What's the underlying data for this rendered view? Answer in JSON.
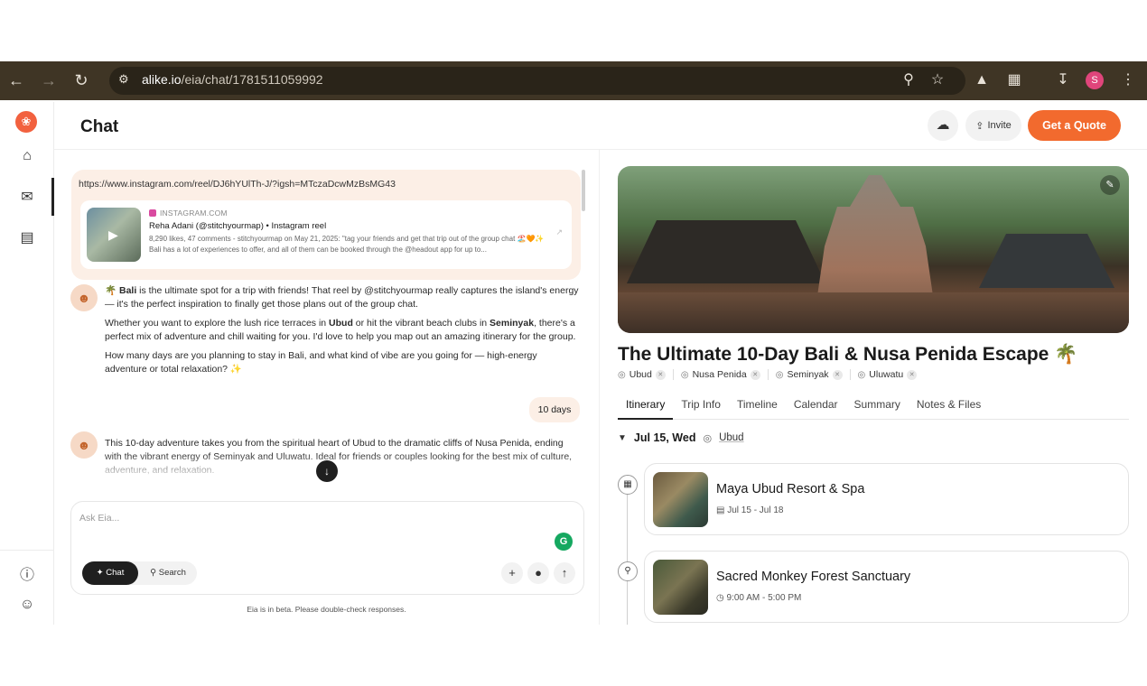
{
  "browser": {
    "url_host": "alike.io",
    "url_path": "/eia/chat/1781511059992",
    "profile_initial": "S"
  },
  "app": {
    "page_title": "Chat",
    "header": {
      "invite_label": "Invite",
      "quote_label": "Get a Quote"
    }
  },
  "chat": {
    "link_message": "https://www.instagram.com/reel/DJ6hYUlTh-J/?igsh=MTczaDcwMzBsMG43",
    "instagram_card": {
      "source": "INSTAGRAM.COM",
      "title": "Reha Adani (@stitchyourmap) • Instagram reel",
      "description": "8,290 likes, 47 comments - stitchyourmap on May 21, 2025: \"tag your friends and get that trip out of the group chat 🏖️🧡✨ Bali has a lot of experiences to offer, and all of them can be booked through the @headout app for up to..."
    },
    "bot_msg1_p1_emoji": "🌴",
    "bot_msg1_p1_bold": "Bali",
    "bot_msg1_p1_rest": " is the ultimate spot for a trip with friends! That reel by @stitchyourmap really captures the island's energy — it's the perfect inspiration to finally get those plans out of the group chat.",
    "bot_msg1_p2_a": "Whether you want to explore the lush rice terraces in ",
    "bot_msg1_p2_b": "Ubud",
    "bot_msg1_p2_c": " or hit the vibrant beach clubs in ",
    "bot_msg1_p2_d": "Seminyak",
    "bot_msg1_p2_e": ", there's a perfect mix of adventure and chill waiting for you. I'd love to help you map out an amazing itinerary for the group.",
    "bot_msg1_p3": "How many days are you planning to stay in Bali, and what kind of vibe are you going for — high-energy adventure or total relaxation? ✨",
    "user_reply": "10 days",
    "bot_msg2": "This 10-day adventure takes you from the spiritual heart of Ubud to the dramatic cliffs of Nusa Penida, ending with the vibrant energy of Seminyak and Uluwatu. Ideal for friends or couples looking for the best mix of culture, adventure, and relaxation.",
    "composer": {
      "placeholder": "Ask Eia...",
      "mode_chat": "Chat",
      "mode_search": "Search"
    },
    "beta_note": "Eia is in beta. Please double-check responses."
  },
  "trip": {
    "title": "The Ultimate 10-Day Bali & Nusa Penida Escape 🌴",
    "locations": [
      "Ubud",
      "Nusa Penida",
      "Seminyak",
      "Uluwatu"
    ],
    "tabs": [
      "Itinerary",
      "Trip Info",
      "Timeline",
      "Calendar",
      "Summary",
      "Notes & Files"
    ],
    "active_tab": "Itinerary",
    "day": {
      "date": "Jul 15, Wed",
      "location": "Ubud"
    },
    "items": [
      {
        "name": "Maya Ubud Resort & Spa",
        "meta": "Jul 15 - Jul 18",
        "icon": "hotel-icon",
        "meta_icon": "calendar-icon"
      },
      {
        "name": "Sacred Monkey Forest Sanctuary",
        "meta": "9:00 AM - 5:00 PM",
        "icon": "location-pin-icon",
        "meta_icon": "clock-icon"
      }
    ]
  },
  "colors": {
    "browser_bar": "#3f3525",
    "accent": "#f26a2e",
    "user_bubble": "#fcefe6"
  }
}
